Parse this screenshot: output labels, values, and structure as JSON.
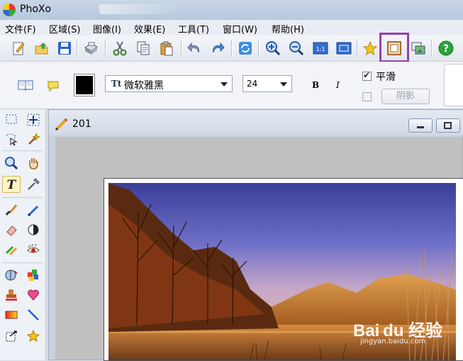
{
  "app": {
    "title": "PhoXo"
  },
  "menu": [
    "文件(F)",
    "区域(S)",
    "图像(I)",
    "效果(E)",
    "工具(T)",
    "窗口(W)",
    "帮助(H)"
  ],
  "text_options": {
    "font_name": "微软雅黑",
    "font_size": "24",
    "bold_label": "B",
    "italic_label": "I",
    "smooth_label": "平滑",
    "smooth_checked": true,
    "shadow_label": "阴影",
    "shadow_checked": false,
    "text_color": "#000000"
  },
  "document": {
    "title": "201"
  },
  "watermark": {
    "logo": "Bai du 经验",
    "url": "jingyan.baidu.com"
  },
  "colors": {
    "highlight": "#9a3fa8",
    "accent_green": "#2aa33a"
  }
}
